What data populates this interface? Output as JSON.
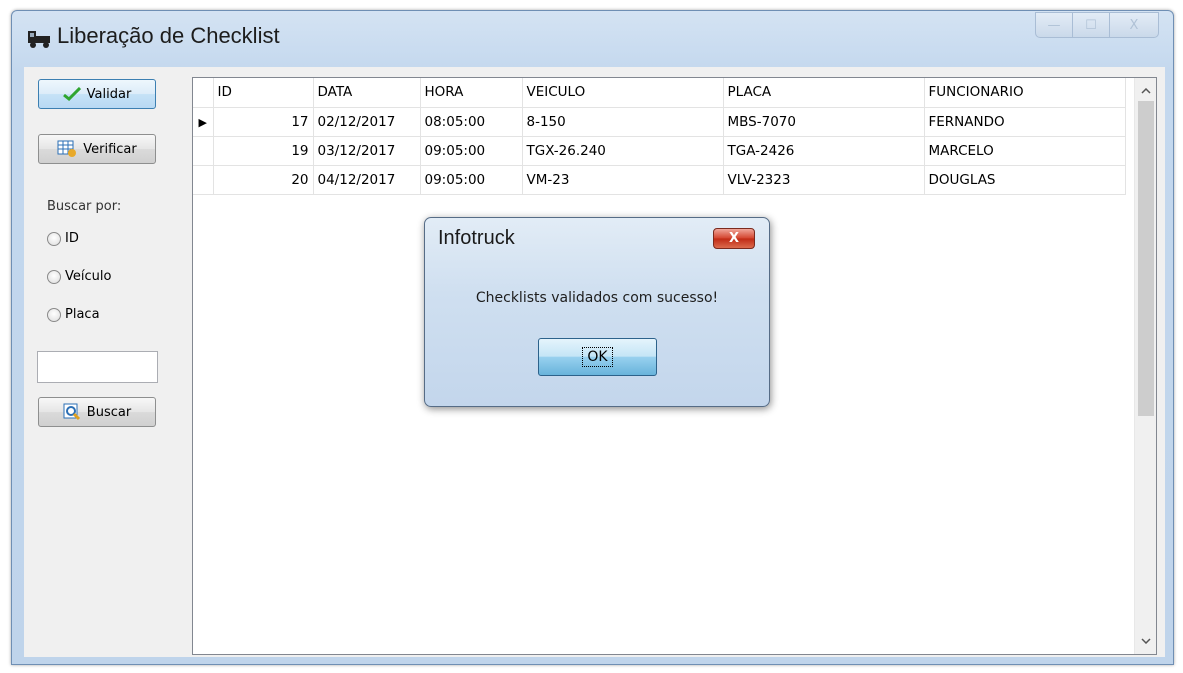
{
  "window": {
    "title": "Liberação de Checklist",
    "controls": {
      "minimize": "—",
      "maximize": "☐",
      "close": "X"
    }
  },
  "toolbar": {
    "validar_label": "Validar",
    "verificar_label": "Verificar",
    "buscar_label": "Buscar"
  },
  "search": {
    "group_label": "Buscar por:",
    "options": [
      "ID",
      "Veículo",
      "Placa"
    ],
    "input_value": ""
  },
  "grid": {
    "columns": [
      "ID",
      "DATA",
      "HORA",
      "VEICULO",
      "PLACA",
      "FUNCIONARIO"
    ],
    "rows": [
      [
        "17",
        "02/12/2017",
        "08:05:00",
        "8-150",
        "MBS-7070",
        "FERNANDO"
      ],
      [
        "19",
        "03/12/2017",
        "09:05:00",
        "TGX-26.240",
        "TGA-2426",
        "MARCELO"
      ],
      [
        "20",
        "04/12/2017",
        "09:05:00",
        "VM-23",
        "VLV-2323",
        "DOUGLAS"
      ]
    ]
  },
  "dialog": {
    "title": "Infotruck",
    "message": "Checklists validados com sucesso!",
    "ok_label": "OK",
    "close_label": "X"
  }
}
